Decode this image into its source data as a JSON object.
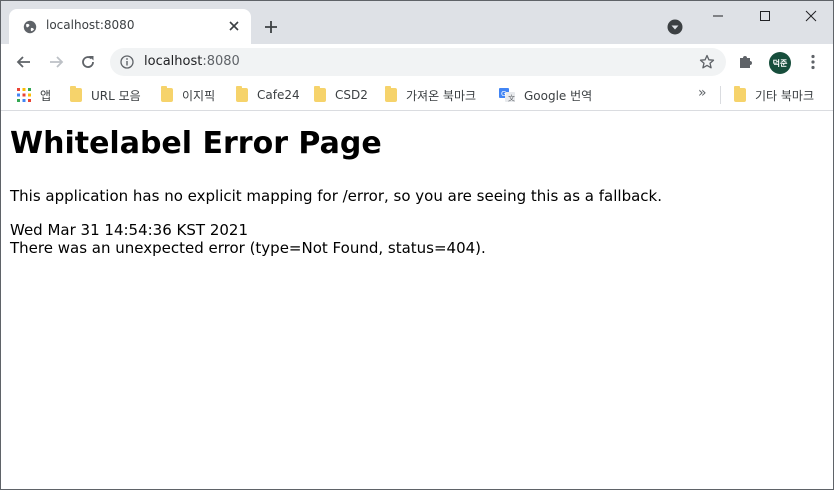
{
  "browser": {
    "tab": {
      "title": "localhost:8080"
    },
    "omnibox": {
      "host": "localhost",
      "port": ":8080"
    },
    "profile": {
      "initials": "덕준"
    },
    "bookmarks": [
      {
        "label": "앱",
        "icon": "apps-grid-icon"
      },
      {
        "label": "URL 모음",
        "icon": "folder-icon"
      },
      {
        "label": "이지픽",
        "icon": "folder-icon"
      },
      {
        "label": "Cafe24",
        "icon": "folder-icon"
      },
      {
        "label": "CSD2",
        "icon": "folder-icon"
      },
      {
        "label": "가져온 북마크",
        "icon": "folder-icon"
      },
      {
        "label": "Google 번역",
        "icon": "google-translate-icon"
      }
    ],
    "overflow_label": "»",
    "other_bookmarks": {
      "label": "기타 북마크",
      "icon": "folder-icon"
    }
  },
  "page": {
    "heading": "Whitelabel Error Page",
    "message": "This application has no explicit mapping for /error, so you are seeing this as a fallback.",
    "timestamp": "Wed Mar 31 14:54:36 KST 2021",
    "error": "There was an unexpected error (type=Not Found, status=404)."
  },
  "colors": {
    "tabstrip": "#dee1e6",
    "omnibox": "#f1f3f4",
    "folder": "#f6d36b",
    "avatar": "#174e3c"
  }
}
